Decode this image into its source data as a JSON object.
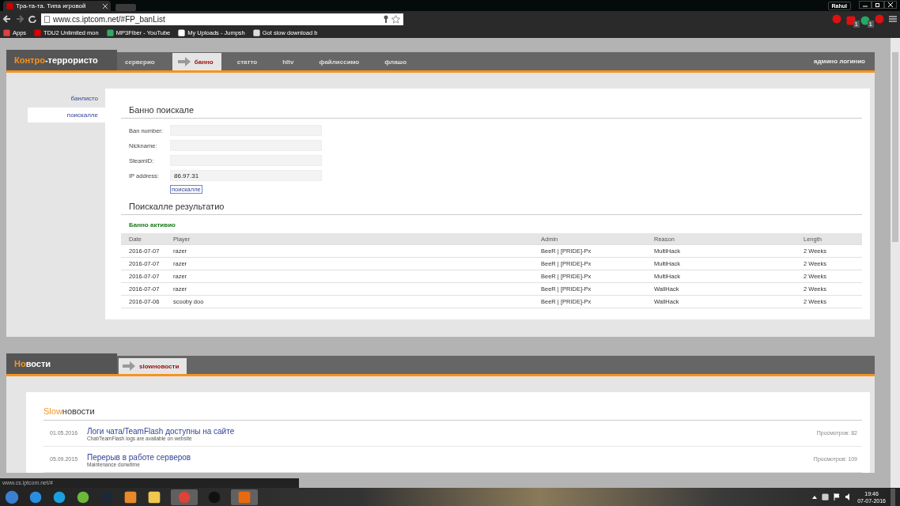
{
  "browser": {
    "tab_title": "Тра-та-та. Типа игровой",
    "profile": "Rahul",
    "url": "www.cs.iptcom.net/#FP_banList",
    "bookmarks": [
      "Apps",
      "TDU2 Unlimited mon",
      "MP3Fiber - YouTube",
      "My Uploads - Jumpsh",
      "Got slow download b"
    ],
    "extension_badges": [
      "1",
      "1"
    ],
    "status_url": "www.cs.iptcom.net/#"
  },
  "site": {
    "logo": {
      "accent": "Контро",
      "rest": "-террористо"
    },
    "nav": [
      {
        "label": "серверио",
        "selected": false
      },
      {
        "label": "банно",
        "selected": true
      },
      {
        "label": "статто",
        "selected": false
      },
      {
        "label": "hltv",
        "selected": false
      },
      {
        "label": "файлиссимо",
        "selected": false
      },
      {
        "label": "флашо",
        "selected": false
      }
    ],
    "admin_login": "админо логинио",
    "sidebar": [
      {
        "label": "банлисто",
        "selected": false
      },
      {
        "label": "поискалле",
        "selected": true
      }
    ],
    "search": {
      "title": "Банно поискале",
      "fields": [
        {
          "label": "Ban number:"
        },
        {
          "label": "Nickname:"
        },
        {
          "label": "SteamID:"
        },
        {
          "label": "IP address:",
          "value": "86.97.31"
        }
      ],
      "button": "поискалле"
    },
    "results": {
      "title": "Поискалле результатио",
      "subtitle": "Банно активио",
      "columns": [
        "Date",
        "Player",
        "Admin",
        "Reason",
        "Length"
      ],
      "rows": [
        [
          "2016-07-07",
          "razer",
          "BeeR | [PRIDE]-Px",
          "MultiHack",
          "2 Weeks"
        ],
        [
          "2016-07-07",
          "razer",
          "BeeR | [PRIDE]-Px",
          "MultiHack",
          "2 Weeks"
        ],
        [
          "2016-07-07",
          "razer",
          "BeeR | [PRIDE]-Px",
          "MultiHack",
          "2 Weeks"
        ],
        [
          "2016-07-07",
          "razer",
          "BeeR | [PRIDE]-Px",
          "WallHack",
          "2 Weeks"
        ],
        [
          "2016-07-06",
          "scooby doo",
          "BeeR | [PRIDE]-Px",
          "WallHack",
          "2 Weeks"
        ]
      ]
    }
  },
  "news": {
    "logo": {
      "accent": "Но",
      "rest": "вости"
    },
    "tab": "slowновости",
    "title": {
      "accent": "Slow",
      "rest": "новости"
    },
    "items": [
      {
        "date": "01.05.2016",
        "title": "Логи чата/TeamFlash доступны на сайте",
        "subtitle": "Chat/TeamFlash logs are available on website",
        "views": "Просмотров: 82"
      },
      {
        "date": "05.09.2015",
        "title": "Перерыв в работе серверов",
        "subtitle": "Maintenance donwtime",
        "views": "Просмотров: 109"
      }
    ]
  },
  "taskbar": {
    "time": "19:46",
    "date": "07-07-2016"
  }
}
